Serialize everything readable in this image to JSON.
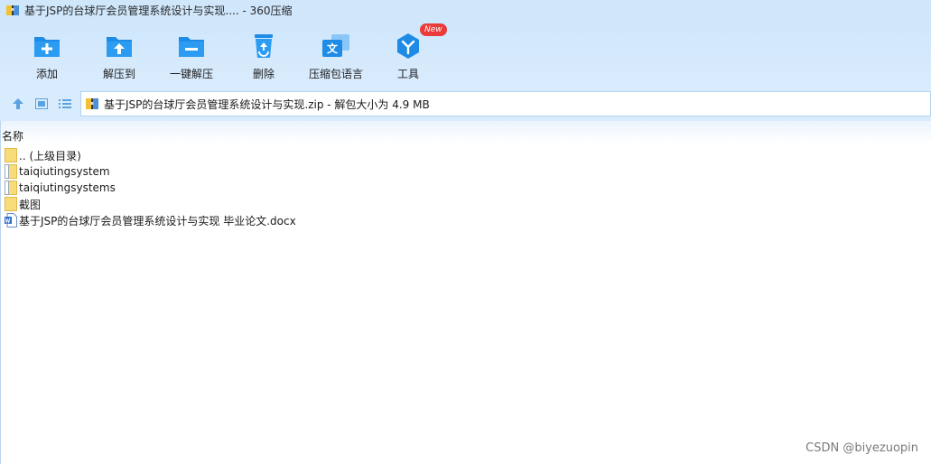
{
  "window": {
    "title": "基于JSP的台球厅会员管理系统设计与实现.... - 360压缩"
  },
  "toolbar": {
    "items": [
      {
        "label": "添加",
        "icon": "add-folder-icon"
      },
      {
        "label": "解压到",
        "icon": "extract-to-icon"
      },
      {
        "label": "一键解压",
        "icon": "one-click-extract-icon"
      },
      {
        "label": "删除",
        "icon": "recycle-icon"
      },
      {
        "label": "压缩包语言",
        "icon": "language-icon"
      },
      {
        "label": "工具",
        "icon": "tools-icon"
      }
    ],
    "new_badge": "New"
  },
  "address": {
    "path": "基于JSP的台球厅会员管理系统设计与实现.zip - 解包大小为 4.9 MB"
  },
  "list": {
    "column_name": "名称",
    "items": [
      {
        "name": ".. (上级目录)",
        "type": "folder"
      },
      {
        "name": "taiqiutingsystem",
        "type": "folder-content"
      },
      {
        "name": "taiqiutingsystems",
        "type": "folder-content"
      },
      {
        "name": "截图",
        "type": "folder"
      },
      {
        "name": "基于JSP的台球厅会员管理系统设计与实现 毕业论文.docx",
        "type": "word-doc"
      }
    ]
  },
  "watermark": "CSDN @biyezuopin",
  "colors": {
    "accent": "#1e8ce6",
    "toolbar_bg": "#d9ecfd",
    "folder": "#f5d56a"
  }
}
